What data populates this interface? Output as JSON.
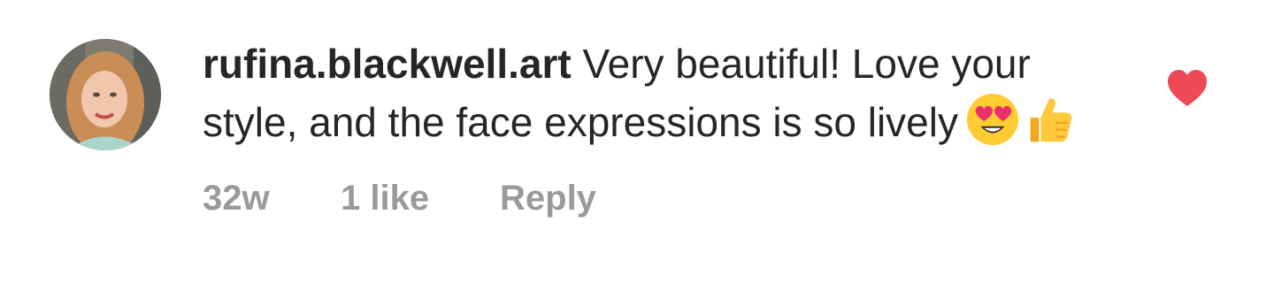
{
  "comment": {
    "username": "rufina.blackwell.art",
    "text": "Very beautiful! Love your style, and the face expressions is so lively",
    "emojis": [
      "heart-eyes-emoji",
      "thumbs-up-emoji"
    ],
    "time": "32w",
    "likes": "1 like",
    "reply_label": "Reply",
    "liked": true,
    "like_icon": "heart-icon",
    "like_color": "#ed4956"
  }
}
